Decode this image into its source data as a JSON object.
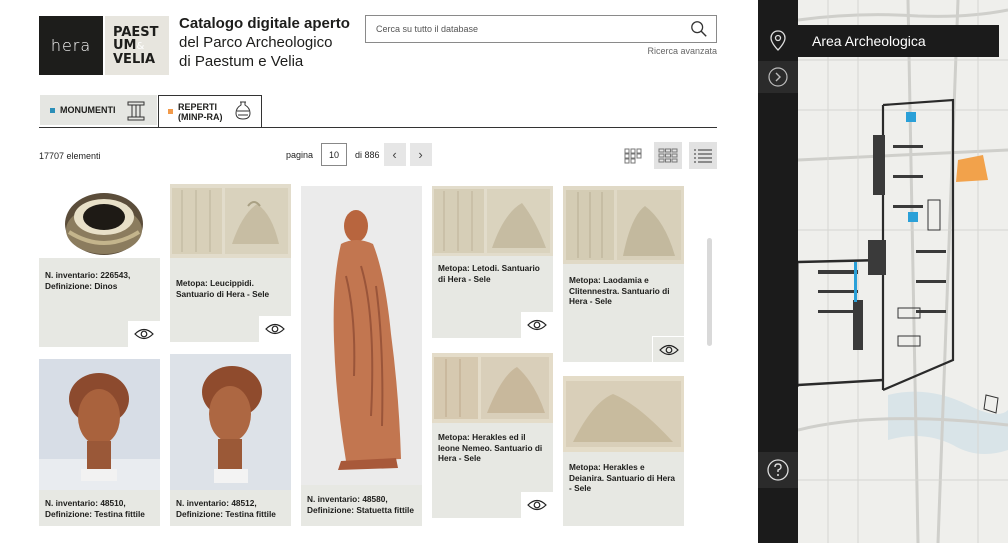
{
  "brand": {
    "hera_logo": "Hera",
    "paestum_logo_lines": [
      "PAEST",
      "UM",
      "&",
      "VELIA"
    ],
    "title_bold": "Catalogo digitale aperto",
    "title_line2": "del Parco Archeologico",
    "title_line3": "di Paestum e Velia"
  },
  "search": {
    "placeholder": "Cerca su tutto il database",
    "icon": "magnifier-icon",
    "advanced_label": "Ricerca avanzata"
  },
  "tabs": [
    {
      "label": "MONUMENTI",
      "color": "#2b8fb8",
      "icon": "column-icon",
      "active": false
    },
    {
      "label": "REPERTI",
      "label_line2": "(MINP-RA)",
      "color": "#f29a4a",
      "icon": "vase-icon",
      "active": true
    }
  ],
  "toolbar": {
    "count_label": "17707 elementi",
    "page_label": "pagina",
    "page_value": "10",
    "page_total": "di 886",
    "prev_icon": "chevron-left-icon",
    "next_icon": "chevron-right-icon",
    "views": [
      "grid-small-icon",
      "grid-large-icon",
      "list-icon"
    ]
  },
  "cards": [
    {
      "caption": "N. inventario: 226543, Definizione: Dinos"
    },
    {
      "caption": "Metopa: Leucippidi. Santuario di Hera - Sele"
    },
    {
      "caption": "N. inventario: 48580, Definizione: Statuetta fittile"
    },
    {
      "caption": "Metopa: Letodi. Santuario di Hera - Sele"
    },
    {
      "caption": "Metopa: Laodamia e Clitennestra. Santuario di Hera - Sele"
    },
    {
      "caption": "N. inventario: 48510, Definizione: Testina fittile"
    },
    {
      "caption": "N. inventario: 48512, Definizione: Testina fittile"
    },
    {
      "caption": "Metopa: Herakles ed il leone Nemeo. Santuario di Hera - Sele"
    },
    {
      "caption": "Metopa: Herakles e Deianira. Santuario di Hera - Sele"
    }
  ],
  "map_panel": {
    "title": "Area Archeologica",
    "pin_icon": "map-pin-icon",
    "expand_icon": "chevron-right-circle-icon",
    "help_icon": "help-icon",
    "accent_blue": "#2aa0d8",
    "accent_orange": "#f2a24b"
  }
}
